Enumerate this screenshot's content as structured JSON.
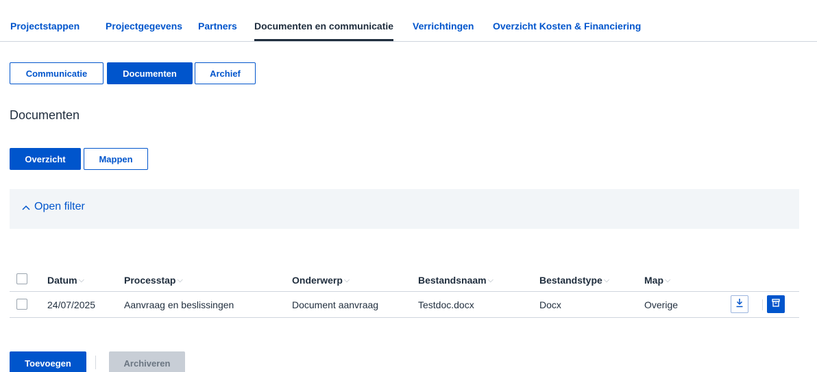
{
  "tabs": [
    {
      "label": "Projectstappen"
    },
    {
      "label": "Projectgegevens"
    },
    {
      "label": "Partners"
    },
    {
      "label": "Documenten en communicatie"
    },
    {
      "label": "Verrichtingen"
    },
    {
      "label": "Overzicht Kosten & Financiering"
    }
  ],
  "active_tab": "Documenten en communicatie",
  "subtabs": {
    "communicatie": "Communicatie",
    "documenten": "Documenten",
    "archief": "Archief"
  },
  "section_title": "Documenten",
  "view_toggle": {
    "overzicht": "Overzicht",
    "mappen": "Mappen"
  },
  "filter": {
    "label": "Open filter",
    "chevron_icon": "chevron-up-icon"
  },
  "table": {
    "columns": [
      "Datum",
      "Processtap",
      "Onderwerp",
      "Bestandsnaam",
      "Bestandstype",
      "Map"
    ],
    "rows": [
      {
        "datum": "24/07/2025",
        "processtap": "Aanvraag en beslissingen",
        "onderwerp": "Document aanvraag",
        "bestandsnaam": "Testdoc.docx",
        "bestandstype": "Docx",
        "map": "Overige",
        "actions": [
          "download-icon",
          "archive-icon"
        ]
      }
    ]
  },
  "actions": {
    "toevoegen": "Toevoegen",
    "archiveren": "Archiveren"
  },
  "colors": {
    "accent": "#0055cc",
    "text": "#1f2d3d",
    "disabled": "#c8ced6",
    "filter_bg": "#f2f5f8"
  }
}
